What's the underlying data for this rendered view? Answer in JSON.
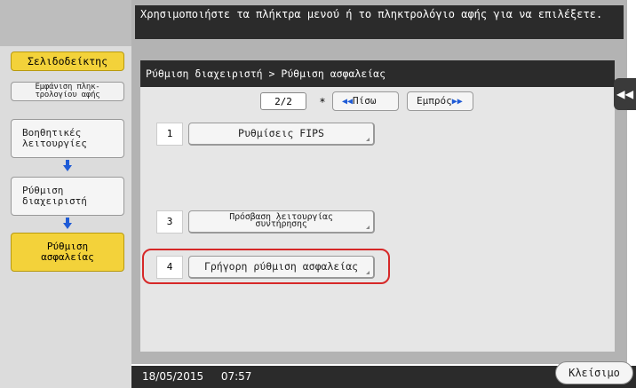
{
  "instruction": "Χρησιμοποιήστε τα πλήκτρα μενού ή το πληκτρολόγιο αφής για να επιλέξετε.",
  "sidebar": {
    "bookmark": "Σελιδοδείκτης",
    "keypad_line1": "Εμφάνιση πληκ-",
    "keypad_line2": "τρολογίου αφής",
    "aux_line1": "Βοηθητικές",
    "aux_line2": "λειτουργίες",
    "admin_line1": "Ρύθμιση",
    "admin_line2": "διαχειριστή",
    "security_line1": "Ρύθμιση",
    "security_line2": "ασφαλείας"
  },
  "breadcrumb": "Ρύθμιση διαχειριστή > Ρύθμιση ασφαλείας",
  "pagination": {
    "page": "2/2",
    "star": "*",
    "prev_label": "Πίσω",
    "next_label": "Εμπρός",
    "prev_arrows": "◀◀",
    "next_arrows": "▶▶"
  },
  "menu": {
    "items": [
      {
        "number": "1",
        "label": "Ρυθμίσεις FIPS"
      },
      {
        "number": "3",
        "label_line1": "Πρόσβαση λειτουργίας",
        "label_line2": "συντήρησης"
      },
      {
        "number": "4",
        "label": "Γρήγορη ρύθμιση ασφαλείας"
      }
    ]
  },
  "collapse_icon": "◀◀",
  "footer": {
    "date": "18/05/2015",
    "time": "07:57",
    "close_label": "Κλείσιμο"
  }
}
